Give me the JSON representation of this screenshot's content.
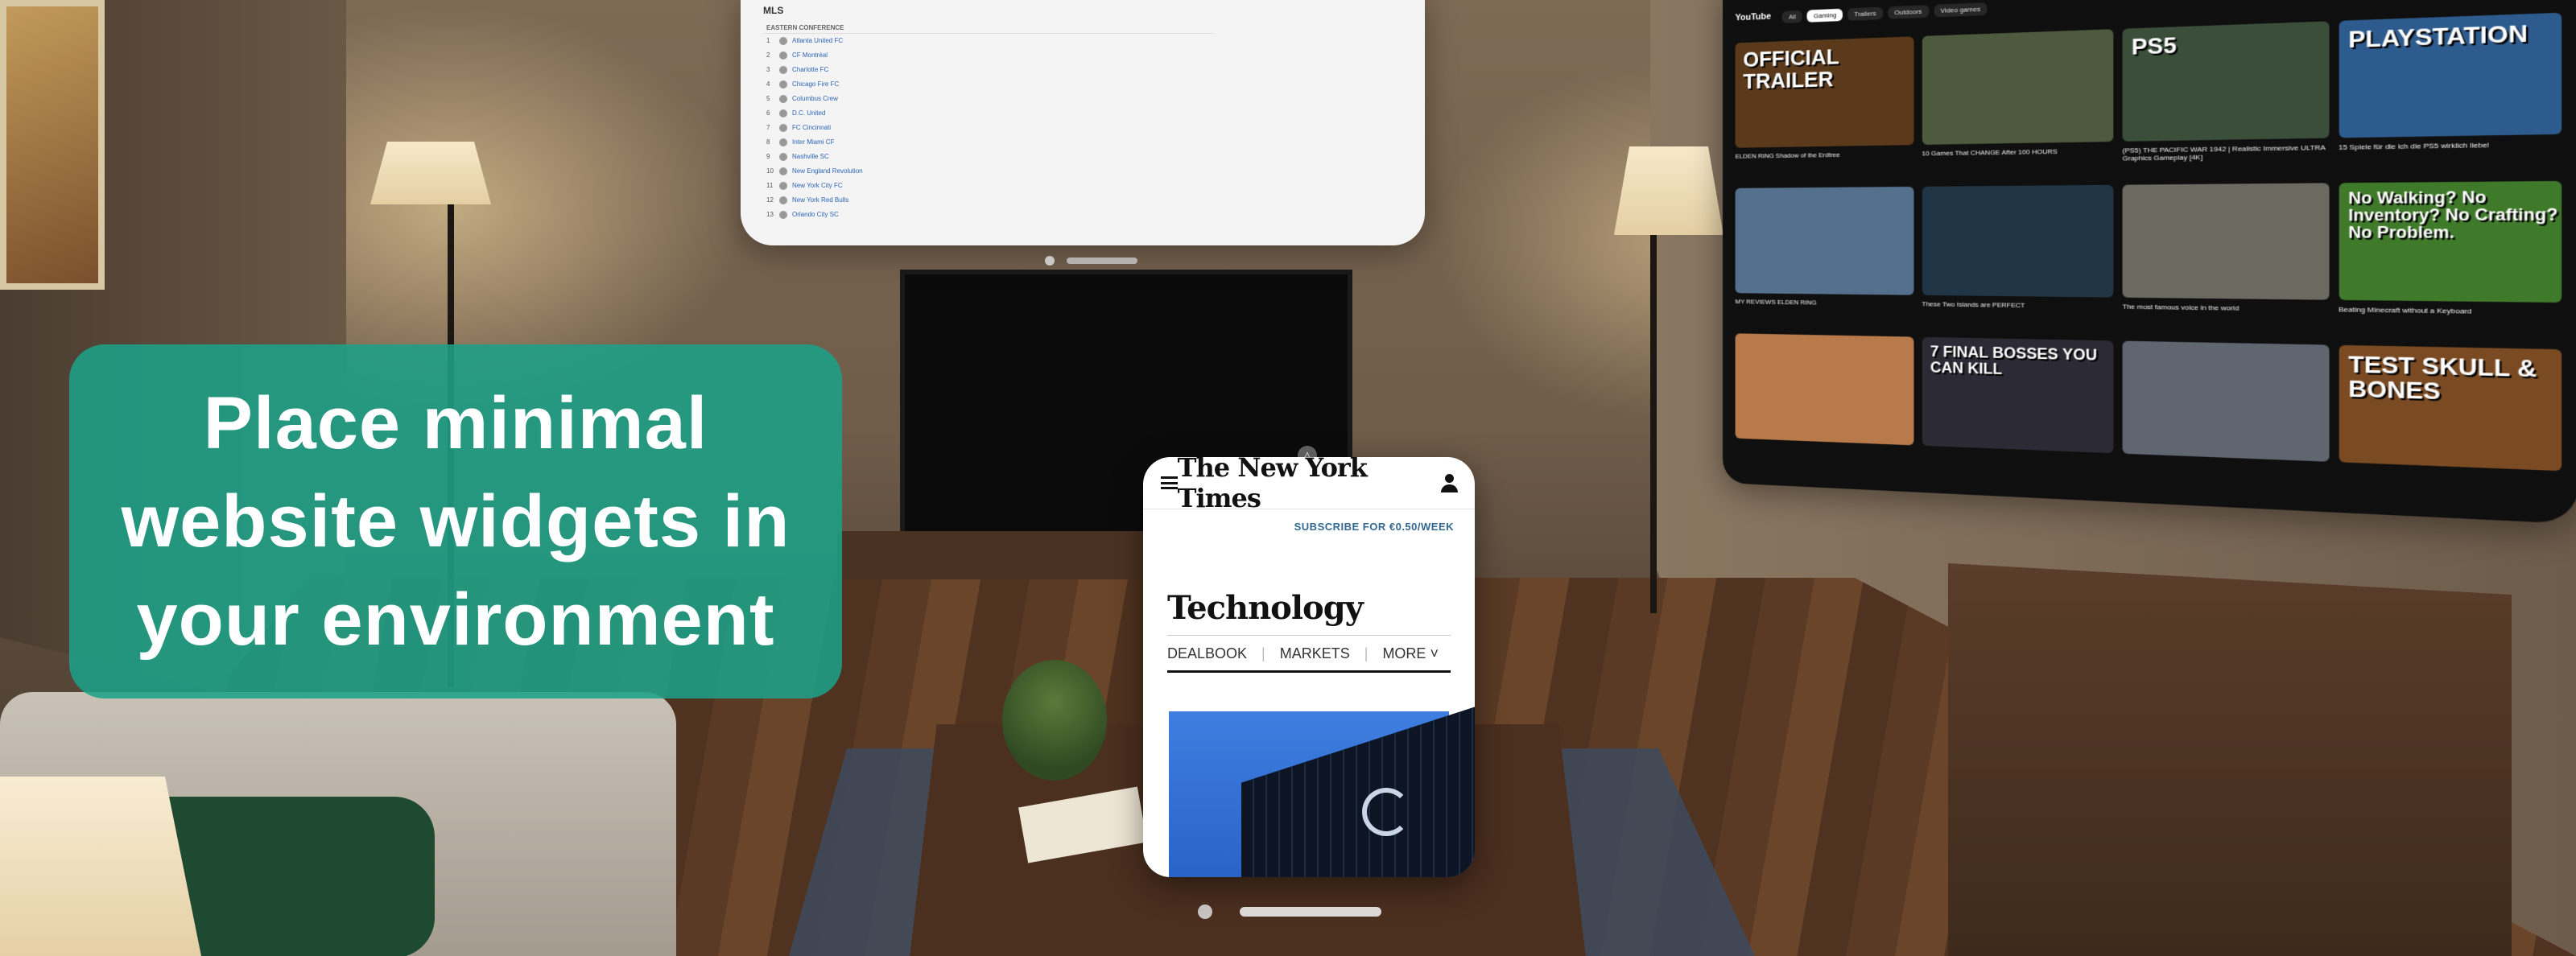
{
  "callout": {
    "line1": "Place minimal",
    "line2": "website widgets in",
    "line3": "your environment"
  },
  "nyt": {
    "logo": "The New York Times",
    "subscribe": "SUBSCRIBE FOR €0.50/WEEK",
    "section": "Technology",
    "nav": [
      "DEALBOOK",
      "MARKETS",
      "MORE"
    ]
  },
  "mls": {
    "title": "MLS",
    "conference": "EASTERN CONFERENCE",
    "teams": [
      {
        "rank": "1",
        "name": "Atlanta United FC"
      },
      {
        "rank": "2",
        "name": "CF Montréal"
      },
      {
        "rank": "3",
        "name": "Charlotte FC"
      },
      {
        "rank": "4",
        "name": "Chicago Fire FC"
      },
      {
        "rank": "5",
        "name": "Columbus Crew"
      },
      {
        "rank": "6",
        "name": "D.C. United"
      },
      {
        "rank": "7",
        "name": "FC Cincinnati"
      },
      {
        "rank": "8",
        "name": "Inter Miami CF"
      },
      {
        "rank": "9",
        "name": "Nashville SC"
      },
      {
        "rank": "10",
        "name": "New England Revolution"
      },
      {
        "rank": "11",
        "name": "New York City FC"
      },
      {
        "rank": "12",
        "name": "New York Red Bulls"
      },
      {
        "rank": "13",
        "name": "Orlando City SC"
      }
    ]
  },
  "youtube": {
    "logo": "YouTube",
    "chips": [
      "All",
      "Gaming",
      "Trailers",
      "Outdoors",
      "Video games"
    ],
    "videos": [
      {
        "overlay": "OFFICIAL TRAILER",
        "title": "ELDEN RING Shadow of the Erdtree",
        "bg": "#5a3a1a"
      },
      {
        "overlay": "",
        "title": "10 Games That CHANGE After 100 HOURS",
        "bg": "#4d5a3d"
      },
      {
        "overlay": "PS5",
        "title": "(PS5) THE PACIFIC WAR 1942 | Realistic Immersive ULTRA Graphics Gameplay [4K]",
        "bg": "#3b4e3a"
      },
      {
        "overlay": "PLAYSTATION",
        "title": "15 Spiele für die ich die PS5 wirklich liebe!",
        "bg": "#2d5b8e"
      },
      {
        "overlay": "",
        "title": "MY REVIEWS ELDEN RING",
        "bg": "#55708c"
      },
      {
        "overlay": "",
        "title": "These Two Islands are PERFECT",
        "bg": "#203646"
      },
      {
        "overlay": "",
        "title": "The most famous voice in the world",
        "bg": "#6a6a60"
      },
      {
        "overlay": "No Walking? No Inventory? No Crafting? No Problem.",
        "title": "Beating Minecraft without a Keyboard",
        "bg": "#3f7a2a"
      },
      {
        "overlay": "",
        "title": "",
        "bg": "#b87a4a"
      },
      {
        "overlay": "7 FINAL BOSSES YOU CAN KILL",
        "title": "",
        "bg": "#2c2a34"
      },
      {
        "overlay": "",
        "title": "",
        "bg": "#5f6670"
      },
      {
        "overlay": "TEST SKULL & BONES",
        "title": "",
        "bg": "#7a4a22"
      }
    ]
  },
  "colors": {
    "callout_bg": "#1ca087",
    "nyt_link": "#326891"
  }
}
